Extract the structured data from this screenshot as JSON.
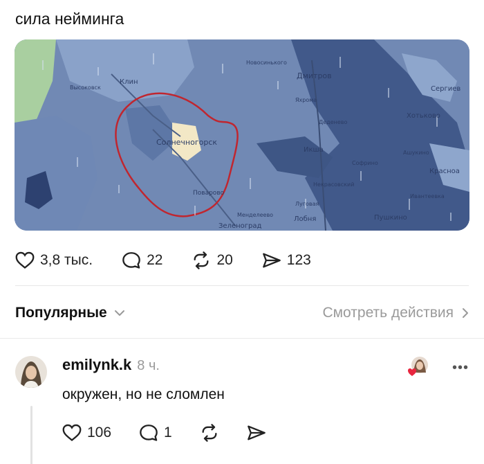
{
  "post": {
    "text": "сила нейминга",
    "map_labels": {
      "solnechnogorsk": "Солнечногорск",
      "dmitrov": "Дмитров",
      "klin": "Клин",
      "sergiev": "Сергиев",
      "khotkovo": "Хотьково",
      "krasnoarm": "Красноа",
      "pushkino": "Пушкино",
      "zelenograd": "Зеленоград",
      "lobnya": "Лобня",
      "ikhsha": "Икша",
      "povarovo": "Поварово",
      "vysokovsk": "Высоковск",
      "novosinkovo": "Новосинького",
      "lugovaya": "Луговая",
      "nekrasovsky": "Некрасовский",
      "mendeleevo": "Менделеево",
      "sofrino": "Софрино",
      "ashukino": "Ашукино",
      "ivanteevka": "Ивантеевка",
      "yakhroma": "Яхрома",
      "deденево": "Деденево"
    },
    "stats": {
      "likes": "3,8 тыс.",
      "comments": "22",
      "reposts": "20",
      "shares": "123"
    }
  },
  "sort": {
    "label": "Популярные",
    "view_actions": "Смотреть действия"
  },
  "comment": {
    "username": "emilynk.k",
    "time": "8 ч.",
    "text": "окружен, но не сломлен",
    "more": "•••",
    "stats": {
      "likes": "106",
      "replies": "1"
    }
  },
  "colors": {
    "map_base": "#7189b4",
    "map_dark": "#3e5685",
    "map_light": "#9cb1d2",
    "highlight": "#f3e8c6",
    "circle": "#c0262f",
    "like_red": "#e8263f"
  }
}
